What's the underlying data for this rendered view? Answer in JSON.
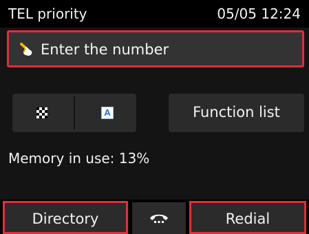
{
  "status": {
    "mode": "TEL priority",
    "datetime": "05/05 12:24"
  },
  "number_field": {
    "label": "Enter the number",
    "icon": "hand-pointer-icon",
    "highlight_color": "#e0303a"
  },
  "mode_buttons": {
    "left_icon": "checker-pattern-icon",
    "right_icon": "text-mode-icon",
    "right_icon_glyph": "A"
  },
  "function_list": {
    "label": "Function list"
  },
  "memory": {
    "text": "Memory in use: 13%",
    "percent": 13
  },
  "softkeys": {
    "directory": "Directory",
    "hook_icon": "phone-hook-icon",
    "redial": "Redial"
  },
  "colors": {
    "background": "#141414",
    "button": "#2b2b2b",
    "field": "#333333",
    "highlight": "#e0303a"
  }
}
